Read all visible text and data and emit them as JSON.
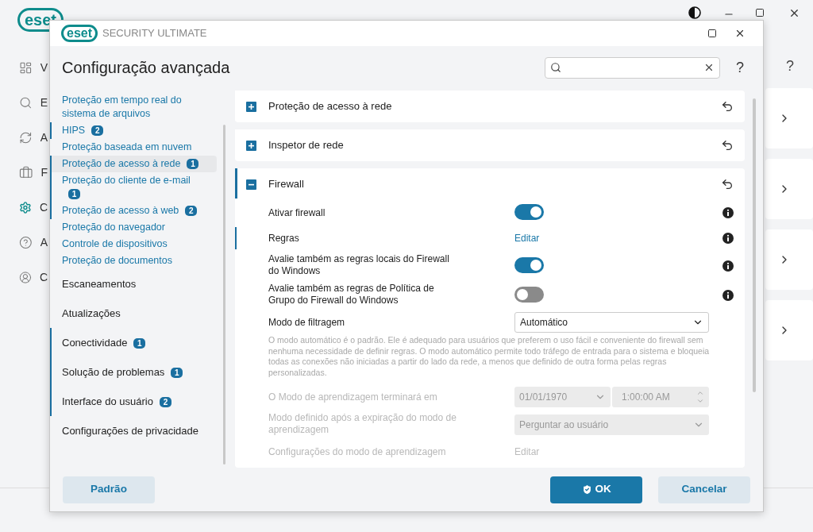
{
  "background_app": {
    "brand": "eset",
    "nav_items": [
      {
        "label": "V",
        "selected": false
      },
      {
        "label": "E",
        "selected": false
      },
      {
        "label": "A",
        "selected": false
      },
      {
        "label": "F",
        "selected": false
      },
      {
        "label": "C",
        "selected": true
      },
      {
        "label": "A",
        "selected": false
      },
      {
        "label": "C",
        "selected": false
      }
    ],
    "help": "?"
  },
  "dialog": {
    "brand": "eset",
    "product": "SECURITY ULTIMATE",
    "title": "Configuração avançada",
    "help": "?",
    "sidebar": [
      {
        "kind": "sub",
        "label": "Proteção em tempo real do sistema de arquivos",
        "marked": false,
        "selected": false
      },
      {
        "kind": "sub",
        "label": "HIPS",
        "badge": "2",
        "marked": true,
        "selected": false
      },
      {
        "kind": "sub",
        "label": "Proteção baseada em nuvem",
        "marked": false,
        "selected": false
      },
      {
        "kind": "sub",
        "label": "Proteção de acesso à rede",
        "badge": "1",
        "marked": true,
        "selected": true
      },
      {
        "kind": "sub",
        "label": "Proteção do cliente de e-mail",
        "badge": "1",
        "marked": true,
        "selected": false
      },
      {
        "kind": "sub",
        "label": "Proteção de acesso à web",
        "badge": "2",
        "marked": true,
        "selected": false
      },
      {
        "kind": "sub",
        "label": "Proteção do navegador",
        "marked": false,
        "selected": false
      },
      {
        "kind": "sub",
        "label": "Controle de dispositivos",
        "marked": false,
        "selected": false
      },
      {
        "kind": "sub",
        "label": "Proteção de documentos",
        "marked": false,
        "selected": false
      },
      {
        "kind": "category",
        "label": "Escaneamentos",
        "marked": false,
        "selected": false
      },
      {
        "kind": "category",
        "label": "Atualizações",
        "marked": false,
        "selected": false
      },
      {
        "kind": "category",
        "label": "Conectividade",
        "badge": "1",
        "marked": true,
        "selected": false
      },
      {
        "kind": "category",
        "label": "Solução de problemas",
        "badge": "1",
        "marked": true,
        "selected": false
      },
      {
        "kind": "category",
        "label": "Interface do usuário",
        "badge": "2",
        "marked": true,
        "selected": false
      },
      {
        "kind": "category",
        "label": "Configurações de privacidade",
        "marked": false,
        "selected": false
      }
    ],
    "sections": [
      {
        "title": "Proteção de acesso à rede",
        "expanded": false,
        "marked": false
      },
      {
        "title": "Inspetor de rede",
        "expanded": false,
        "marked": false
      },
      {
        "title": "Firewall",
        "expanded": true,
        "marked": true,
        "rows": [
          {
            "kind": "toggle",
            "label": "Ativar firewall",
            "on": true,
            "disabled": false,
            "marked": false,
            "info": true
          },
          {
            "kind": "link",
            "label": "Regras",
            "link": "Editar",
            "disabled": false,
            "marked": true,
            "info": true
          },
          {
            "kind": "toggle",
            "label": "Avalie também as regras locais do Firewall do Windows",
            "on": true,
            "disabled": false,
            "marked": false,
            "info": true
          },
          {
            "kind": "toggle",
            "label": "Avalie também as regras de Política de Grupo do Firewall do Windows",
            "on": false,
            "disabled": false,
            "marked": false,
            "info": true
          },
          {
            "kind": "select",
            "label": "Modo de filtragem",
            "value": "Automático",
            "disabled": false,
            "marked": false,
            "info": false,
            "description": "O modo automático é o padrão. Ele é adequado para usuários que preferem o uso fácil e conveniente do firewall sem nenhuma necessidade de definir regras. O modo automático permite todo tráfego de entrada para o sistema e bloqueia todas as conexões não iniciadas a partir do lado da rede, a menos que definido de outra forma pelas regras personalizadas."
          },
          {
            "kind": "datetime",
            "label": "O Modo de aprendizagem terminará em",
            "date": "01/01/1970",
            "time": "1:00:00 AM",
            "disabled": true,
            "marked": false,
            "info": false
          },
          {
            "kind": "select",
            "label": "Modo definido após a expiração do modo de aprendizagem",
            "value": "Perguntar ao usuário",
            "disabled": true,
            "marked": false,
            "info": false
          },
          {
            "kind": "link",
            "label": "Configurações do modo de aprendizagem",
            "link": "Editar",
            "disabled": true,
            "marked": false,
            "info": false
          }
        ]
      }
    ],
    "buttons": [
      {
        "kind": "secondary",
        "label": "Padrão"
      },
      {
        "kind": "primary",
        "label": "OK"
      },
      {
        "kind": "secondary",
        "label": "Cancelar"
      }
    ]
  }
}
